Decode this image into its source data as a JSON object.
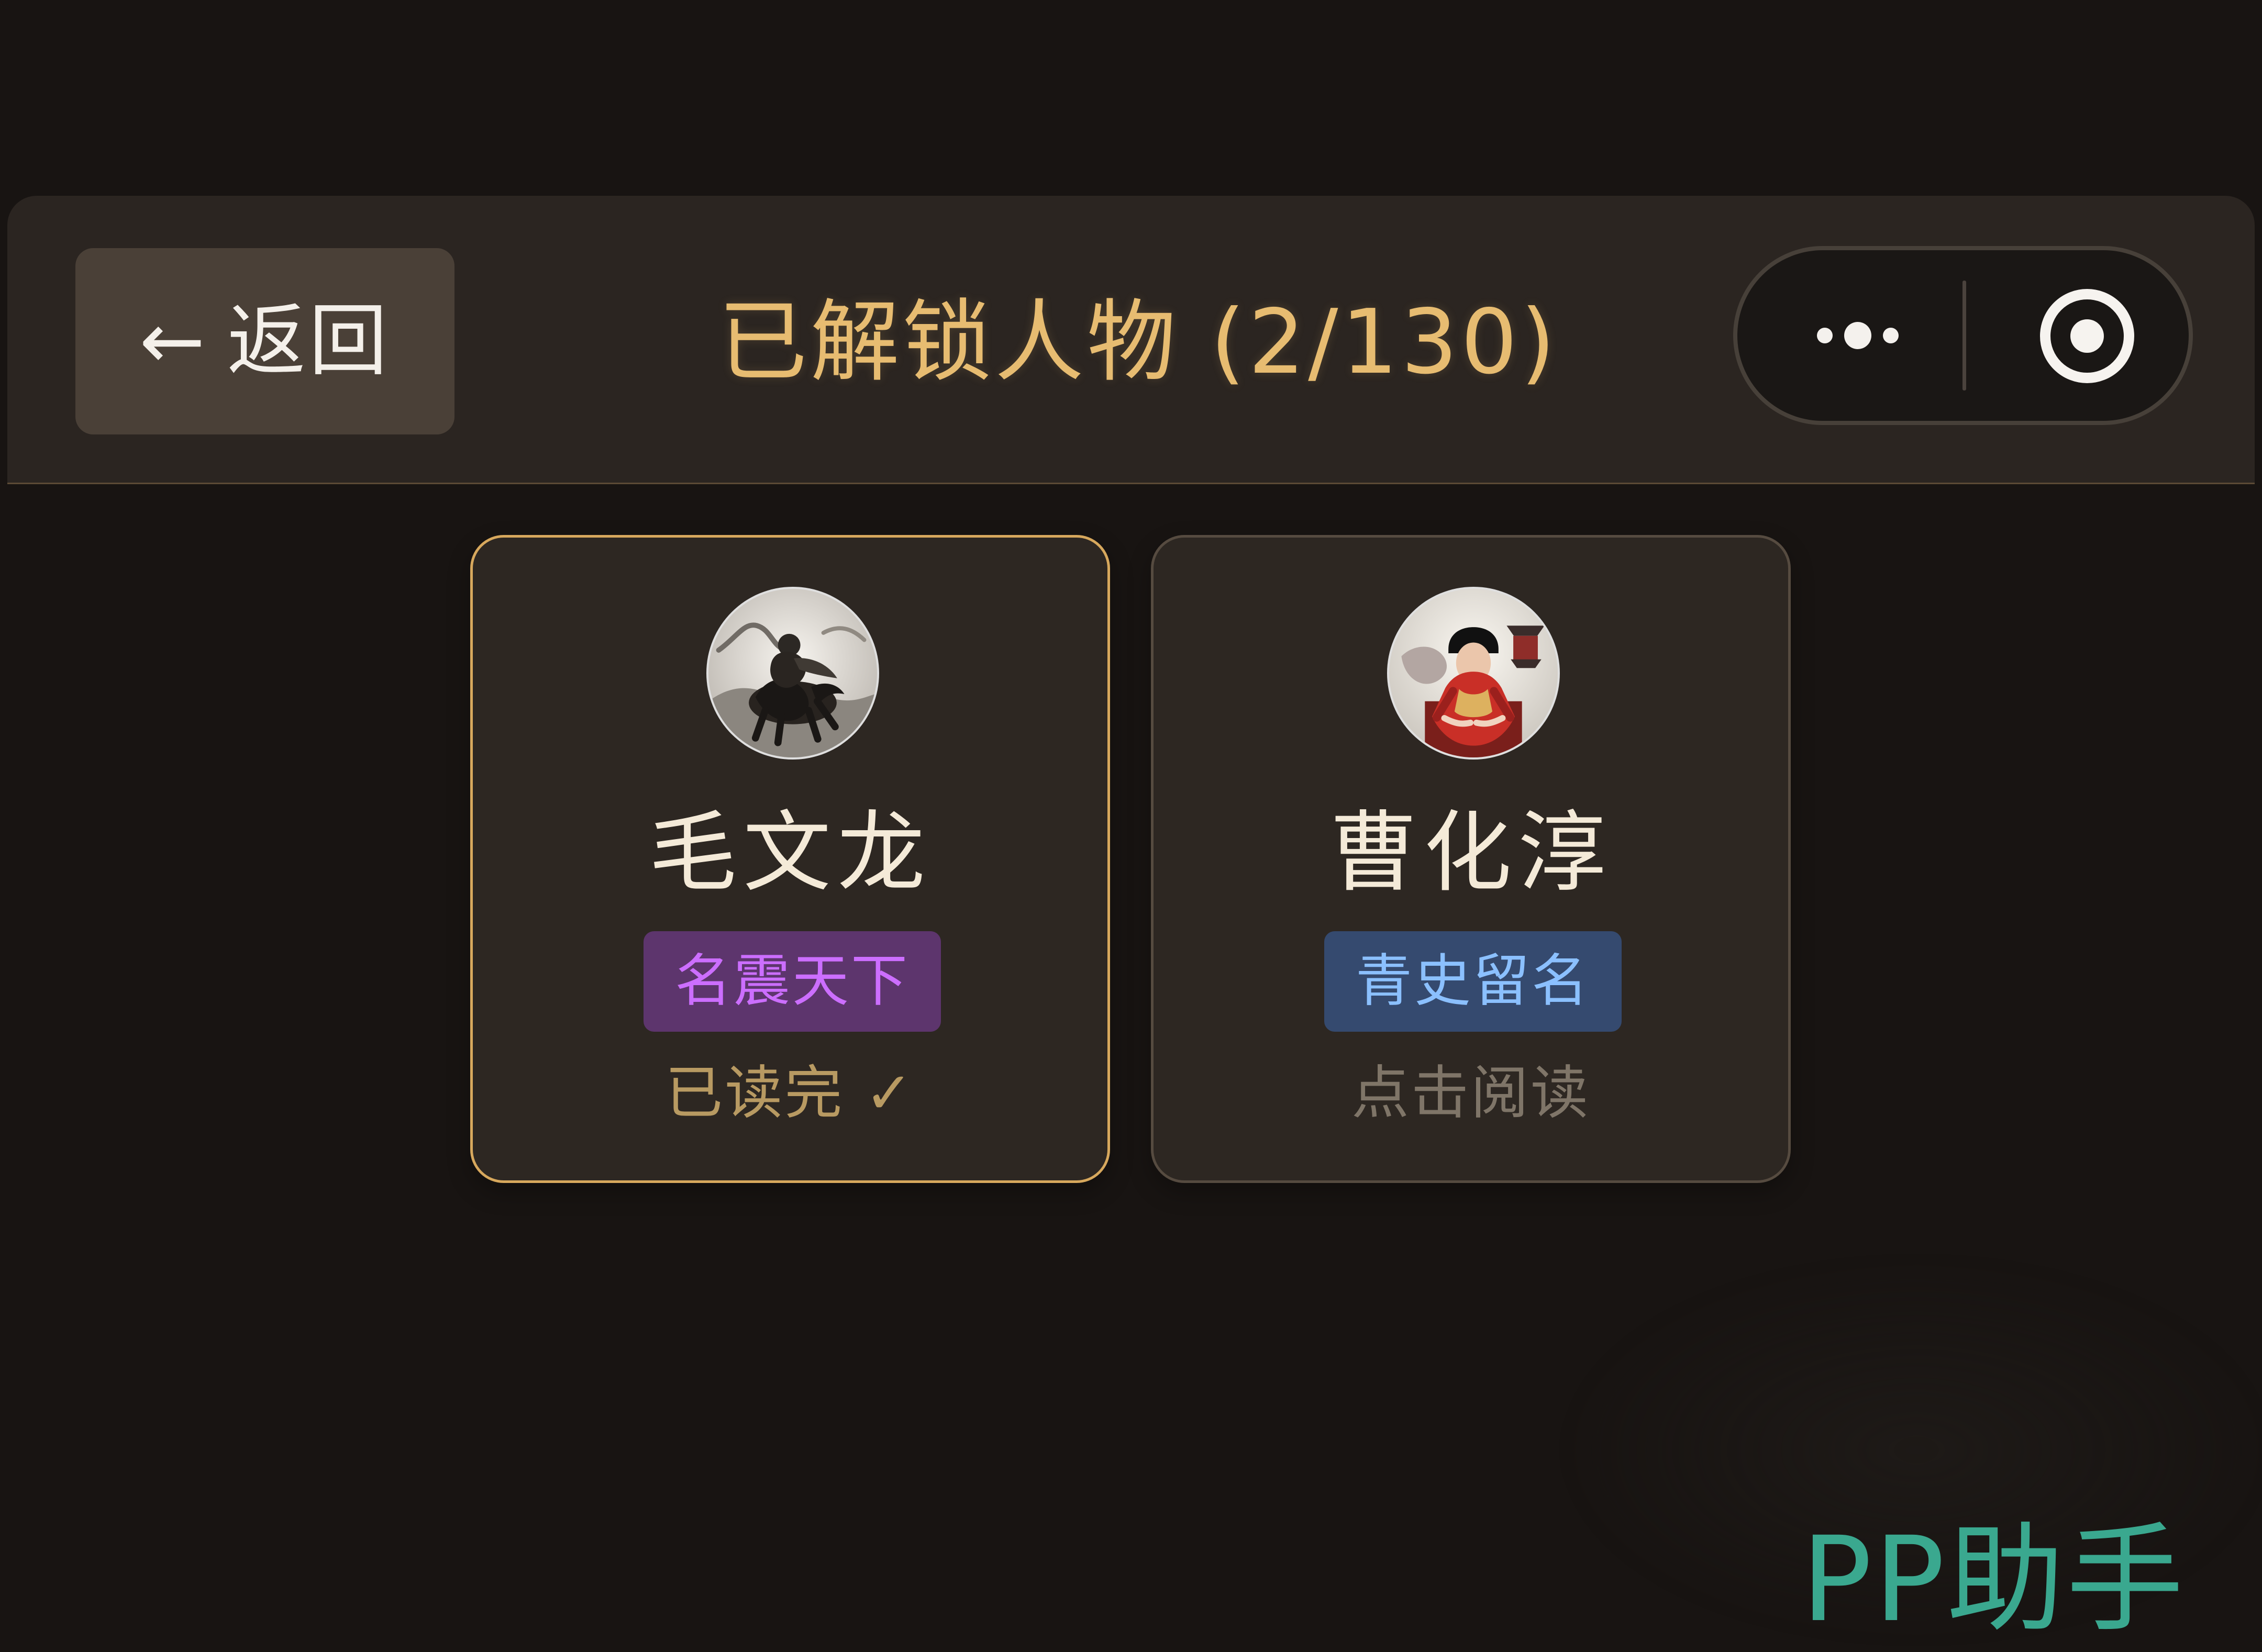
{
  "header": {
    "back_arrow": "←",
    "back_label": "返回",
    "title": "已解锁人物 (2/130)",
    "more_icon": "more-dots-icon",
    "target_icon": "target-icon"
  },
  "cards": [
    {
      "name": "毛文龙",
      "badge": "名震天下",
      "status": "已读完 ✓",
      "avatar_icon": "horseman-avatar"
    },
    {
      "name": "曹化淳",
      "badge": "青史留名",
      "status": "点击阅读",
      "avatar_icon": "seated-official-avatar"
    }
  ],
  "watermark": {
    "text": "PP助手"
  },
  "colors": {
    "background": "#181412",
    "header": "#2b2521",
    "accent_gold": "#e7bc71",
    "badge_purple_bg": "#5d356d",
    "badge_purple_text": "#cc6eff",
    "badge_blue_bg": "#354a6f",
    "badge_blue_text": "#8bc0ff",
    "watermark": "#3aa88f"
  }
}
